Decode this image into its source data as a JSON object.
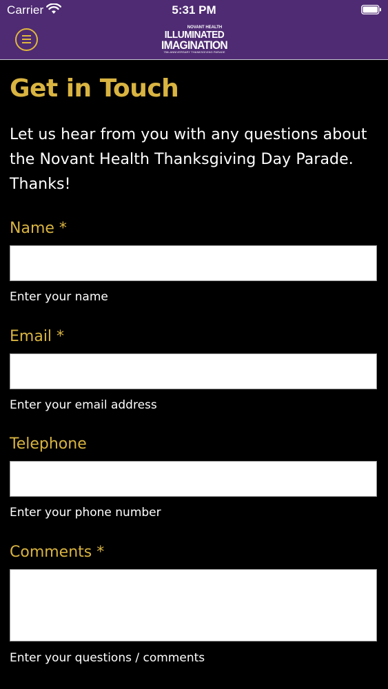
{
  "status_bar": {
    "carrier": "Carrier",
    "time": "5:31 PM"
  },
  "nav": {
    "menu_icon": "hamburger-circle-icon",
    "logo": {
      "brand": "NOVANT HEALTH",
      "line1": "ILLUMINATED",
      "line2": "IMAGINATION",
      "tagline": "75th ANNIVERSARY THANKSGIVING PARADE"
    }
  },
  "page": {
    "title": "Get in Touch",
    "intro": "Let us hear from you with any questions about the Novant Health Thanksgiving Day Parade. Thanks!"
  },
  "form": {
    "name": {
      "label": "Name *",
      "value": "",
      "help": "Enter your name"
    },
    "email": {
      "label": "Email *",
      "value": "",
      "help": "Enter your email address"
    },
    "telephone": {
      "label": "Telephone",
      "value": "",
      "help": "Enter your phone number"
    },
    "comments": {
      "label": "Comments *",
      "value": "",
      "help": "Enter your questions / comments"
    }
  },
  "colors": {
    "nav_background": "#4f2b73",
    "accent_gold": "#d9b441",
    "page_background": "#000000",
    "text": "#ffffff"
  }
}
